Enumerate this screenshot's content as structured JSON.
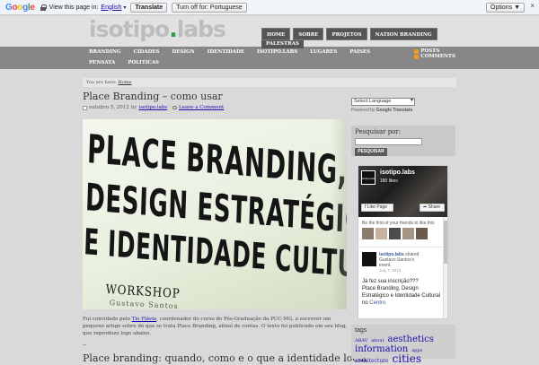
{
  "gtranslate": {
    "brand": "Google",
    "view_text": "View this page in:",
    "language": "English",
    "translate_label": "Translate",
    "turn_off_label": "Turn off for: Portuguese",
    "options_label": "Options ▼",
    "close": "×"
  },
  "header": {
    "logo_text": "isotipo",
    "logo_dot": ".",
    "logo_suffix": "labs",
    "top_nav": [
      "HOME",
      "SOBRE",
      "PROJETOS",
      "NATION BRANDING"
    ],
    "top_nav_extra": "PALESTRAS"
  },
  "categories": [
    "BRANDING",
    "CIDADES",
    "DESIGN",
    "IDENTIDADE",
    "ISOTIPO.LABS",
    "LUGARES",
    "PAISES",
    "PENSATA",
    "POLITICAS"
  ],
  "feeds": [
    "POSTS",
    "COMMENTS"
  ],
  "breadcrumb": {
    "prefix": "You are here:",
    "home": "Home"
  },
  "post": {
    "title": "Place Branding – como usar",
    "date": "outubro 5, 2012",
    "by": "by",
    "author": "isotipo.labs",
    "separator": "·",
    "comment_link": "Leave a Comment",
    "image_lines": [
      "PLACE BRANDING,",
      "DESIGN ESTRATÉGICO",
      "E IDENTIDADE CULTURAL"
    ],
    "image_workshop": "WORKSHOP",
    "image_sub": "Gustavo Santos",
    "body_pre": "Fui convidado pelo",
    "body_link": "Tio Flávio",
    "body_post": ", coordenador do curso de Pós-Graduação da PUC-MG, a escrever um pequeno artigo sobre do que se trata Place Branding, afinal de contas. O texto foi publicado em seu blog, que reproduzo logo abaixo.",
    "dash": "--",
    "next_line": "Place branding: quando, como e o que a identidade local"
  },
  "sidebar": {
    "select_language": "Select Language",
    "powered_by": "Powered by",
    "powered_brand": "Google",
    "powered_translate": "Translate",
    "search_label": "Pesquisar por:",
    "search_button": "PESQUISAR",
    "fb": {
      "thumb_text": "isotipo.labs",
      "name": "isotipo.labs",
      "likes": "180 likes",
      "like_button": "Like Page",
      "share_button": "Share",
      "friends_text": "Be the first of your friends to like this",
      "post_name": "isotipo.labs",
      "post_action": "shared",
      "post_who": "Gustavo Santos's",
      "post_event": "event.",
      "post_date": "July 7, 2013",
      "message_1": "Já fez sua inscrição???",
      "message_2": "Place Branding, Design Estratégico e Identidade Cultural no",
      "message_link": "Centro"
    },
    "tags_title": "tags",
    "tags": [
      {
        "text": "ABAV",
        "size": "s1"
      },
      {
        "text": "about",
        "size": "s1"
      },
      {
        "text": "aesthetics",
        "size": "s4"
      },
      {
        "text": "information",
        "size": "s4"
      },
      {
        "text": "apps",
        "size": "s1"
      },
      {
        "text": "architecture",
        "size": "s2"
      },
      {
        "text": "cities",
        "size": "s5"
      }
    ]
  }
}
